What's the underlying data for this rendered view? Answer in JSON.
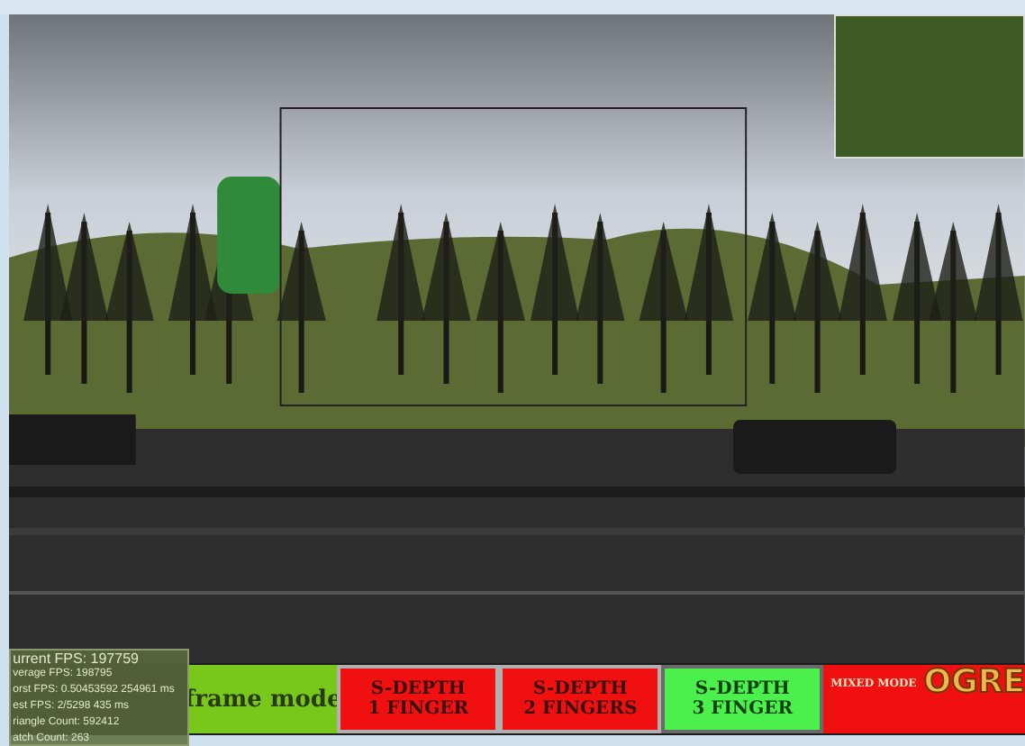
{
  "stats_overlay": {
    "lines": [
      "urrent FPS: 197759",
      "verage FPS: 198795",
      "orst FPS: 0.50453592 254961 ms",
      "est FPS: 2/5298 435 ms",
      "riangle Count: 592412",
      "atch Count: 263"
    ]
  },
  "mode_buttons": [
    {
      "kind": "mode",
      "lines": [
        "frame mode"
      ],
      "selected": false
    },
    {
      "kind": "depth",
      "lines": [
        "S-DEPTH",
        "1 FINGER"
      ],
      "selected": false
    },
    {
      "kind": "depth",
      "lines": [
        "S-DEPTH",
        "2 FINGERS"
      ],
      "selected": false
    },
    {
      "kind": "depth",
      "lines": [
        "S-DEPTH",
        "3 FINGER"
      ],
      "selected": true
    },
    {
      "kind": "mixed",
      "lines": [
        "MIXED MODE"
      ],
      "selected": false
    }
  ],
  "logo": "OGRE"
}
